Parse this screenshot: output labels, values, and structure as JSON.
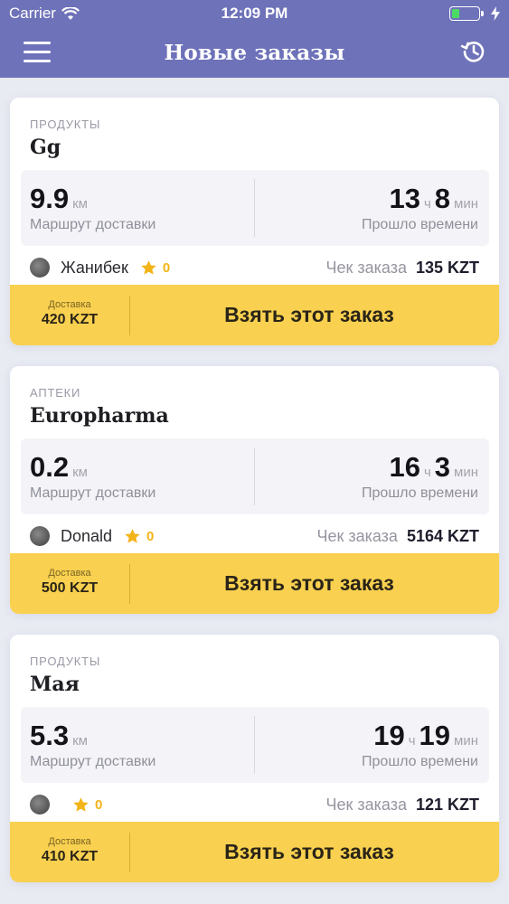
{
  "status_bar": {
    "carrier": "Carrier",
    "time": "12:09 PM"
  },
  "header": {
    "title": "Новые заказы"
  },
  "colors": {
    "header": "#6e72b9",
    "accent_yellow": "#f9d04f",
    "star": "#f2b418",
    "battery": "#4cd964"
  },
  "icons": {
    "menu": "hamburger-menu-icon",
    "history": "history-clock-icon",
    "wifi": "wifi-icon",
    "battery": "battery-icon",
    "charging": "bolt-icon",
    "star": "star-icon"
  },
  "orders": [
    {
      "category": "ПРОДУКТЫ",
      "title": "Gg",
      "distance": "9.9",
      "distance_unit": "км",
      "distance_label": "Маршрут доставки",
      "hours": "13",
      "hours_unit": "ч",
      "minutes": "8",
      "minutes_unit": "мин",
      "elapsed_label": "Прошло времени",
      "courier": "Жанибек",
      "rating": "0",
      "check_label": "Чек заказа",
      "check_value": "135 KZT",
      "delivery_label": "Доставка",
      "delivery_price": "420 KZT",
      "action": "Взять этот заказ"
    },
    {
      "category": "АПТЕКИ",
      "title": "Europharma",
      "distance": "0.2",
      "distance_unit": "км",
      "distance_label": "Маршрут доставки",
      "hours": "16",
      "hours_unit": "ч",
      "minutes": "3",
      "minutes_unit": "мин",
      "elapsed_label": "Прошло времени",
      "courier": "Donald",
      "rating": "0",
      "check_label": "Чек заказа",
      "check_value": "5164 KZT",
      "delivery_label": "Доставка",
      "delivery_price": "500 KZT",
      "action": "Взять этот заказ"
    },
    {
      "category": "ПРОДУКТЫ",
      "title": "Мая",
      "distance": "5.3",
      "distance_unit": "км",
      "distance_label": "Маршрут доставки",
      "hours": "19",
      "hours_unit": "ч",
      "minutes": "19",
      "minutes_unit": "мин",
      "elapsed_label": "Прошло времени",
      "courier": "",
      "rating": "0",
      "check_label": "Чек заказа",
      "check_value": "121 KZT",
      "delivery_label": "Доставка",
      "delivery_price": "410 KZT",
      "action": "Взять этот заказ"
    }
  ]
}
